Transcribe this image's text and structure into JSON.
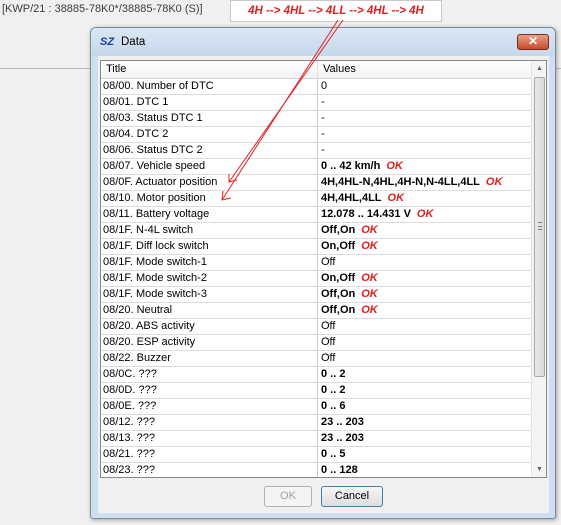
{
  "background": {
    "title": "[KWP/21 : 38885-78K0*/38885-78K0 (S)]"
  },
  "annotation": {
    "text": "4H --> 4HL --> 4LL --> 4HL --> 4H"
  },
  "window": {
    "icon_text": "SZ",
    "title": "Data",
    "close_glyph": "✕"
  },
  "table": {
    "columns": [
      "Title",
      "Values"
    ],
    "rows": [
      {
        "title": "08/00. Number of DTC",
        "value": "0",
        "bold": false,
        "mark": ""
      },
      {
        "title": "08/01. DTC 1",
        "value": "-",
        "bold": false,
        "mark": ""
      },
      {
        "title": "08/03. Status DTC 1",
        "value": "-",
        "bold": false,
        "mark": ""
      },
      {
        "title": "08/04. DTC 2",
        "value": "-",
        "bold": false,
        "mark": ""
      },
      {
        "title": "08/06. Status DTC 2",
        "value": "-",
        "bold": false,
        "mark": ""
      },
      {
        "title": "08/07. Vehicle speed",
        "value": "0 .. 42 km/h",
        "bold": true,
        "mark": "OK"
      },
      {
        "title": "08/0F. Actuator position",
        "value": "4H,4HL-N,4HL,4H-N,N-4LL,4LL",
        "bold": true,
        "mark": "OK"
      },
      {
        "title": "08/10. Motor position",
        "value": "4H,4HL,4LL",
        "bold": true,
        "mark": "OK"
      },
      {
        "title": "08/11. Battery voltage",
        "value": "12.078 .. 14.431 V",
        "bold": true,
        "mark": "OK"
      },
      {
        "title": "08/1F. N-4L switch",
        "value": "Off,On",
        "bold": true,
        "mark": "OK"
      },
      {
        "title": "08/1F. Diff lock switch",
        "value": "On,Off",
        "bold": true,
        "mark": "OK"
      },
      {
        "title": "08/1F. Mode switch-1",
        "value": "Off",
        "bold": false,
        "mark": ""
      },
      {
        "title": "08/1F. Mode switch-2",
        "value": "On,Off",
        "bold": true,
        "mark": "OK"
      },
      {
        "title": "08/1F. Mode switch-3",
        "value": "Off,On",
        "bold": true,
        "mark": "OK"
      },
      {
        "title": "08/20. Neutral",
        "value": "Off,On",
        "bold": true,
        "mark": "OK"
      },
      {
        "title": "08/20. ABS activity",
        "value": "Off",
        "bold": false,
        "mark": ""
      },
      {
        "title": "08/20. ESP activity",
        "value": "Off",
        "bold": false,
        "mark": ""
      },
      {
        "title": "08/22. Buzzer",
        "value": "Off",
        "bold": false,
        "mark": ""
      },
      {
        "title": "08/0C. ???",
        "value": "0 .. 2",
        "bold": true,
        "mark": ""
      },
      {
        "title": "08/0D. ???",
        "value": "0 .. 2",
        "bold": true,
        "mark": ""
      },
      {
        "title": "08/0E. ???",
        "value": "0 .. 6",
        "bold": true,
        "mark": ""
      },
      {
        "title": "08/12. ???",
        "value": "23 .. 203",
        "bold": true,
        "mark": ""
      },
      {
        "title": "08/13. ???",
        "value": "23 .. 203",
        "bold": true,
        "mark": ""
      },
      {
        "title": "08/21. ???",
        "value": "0 .. 5",
        "bold": true,
        "mark": ""
      },
      {
        "title": "08/23. ???",
        "value": "0 .. 128",
        "bold": true,
        "mark": ""
      }
    ]
  },
  "buttons": {
    "ok": "OK",
    "cancel": "Cancel"
  },
  "colors": {
    "annotation": "#e02020",
    "ok_mark": "#e02020"
  }
}
